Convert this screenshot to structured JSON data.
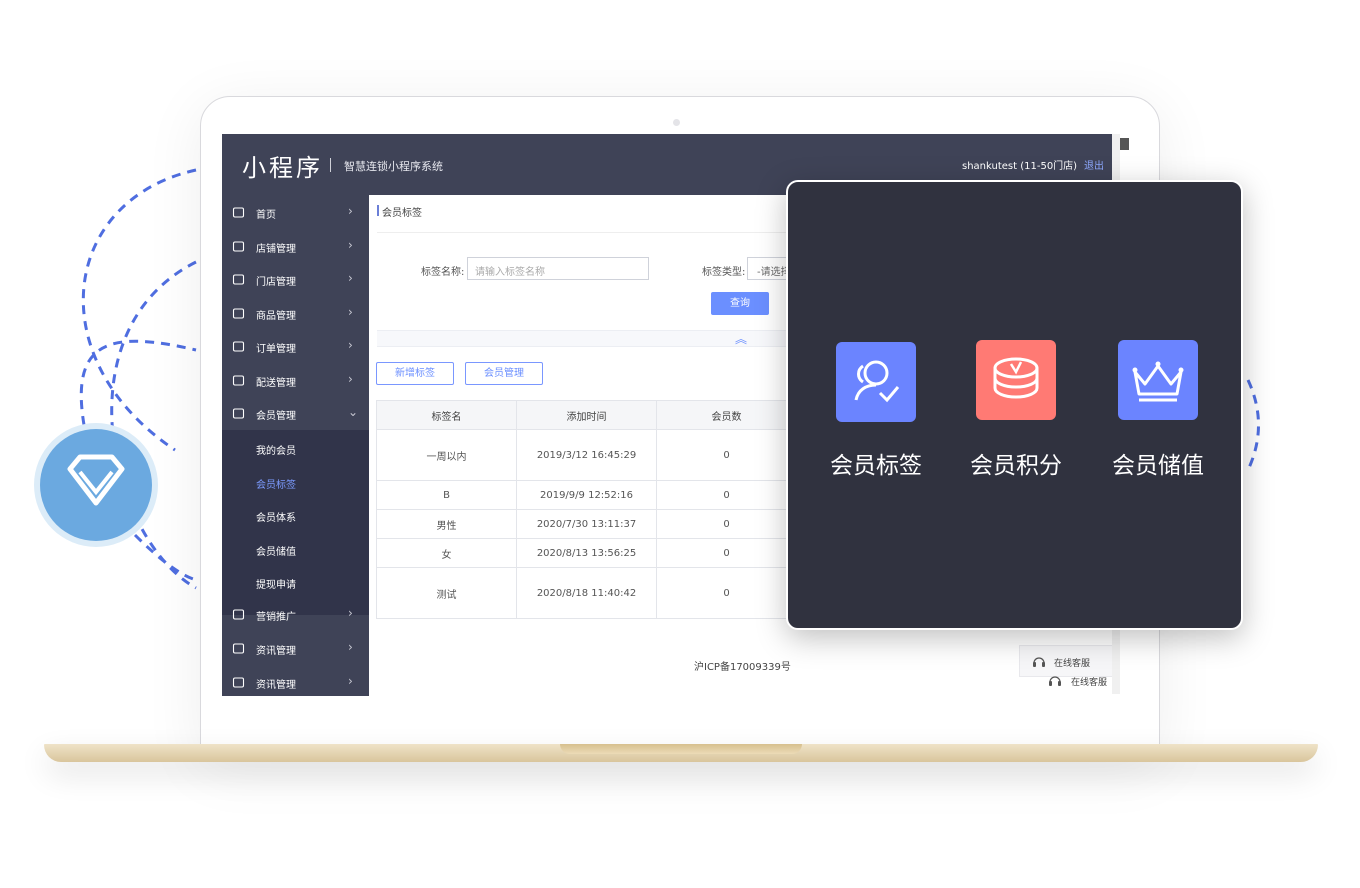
{
  "app": {
    "logo": "小程序",
    "subtitle": "智慧连锁小程序系统",
    "user": "shankutest  (11-50门店)",
    "logout": "退出"
  },
  "sidebar": {
    "items": [
      {
        "label": "首页",
        "icon": "home-icon"
      },
      {
        "label": "店铺管理",
        "icon": "shop-icon"
      },
      {
        "label": "门店管理",
        "icon": "store-icon"
      },
      {
        "label": "商品管理",
        "icon": "goods-icon"
      },
      {
        "label": "订单管理",
        "icon": "order-icon"
      },
      {
        "label": "配送管理",
        "icon": "truck-icon"
      },
      {
        "label": "会员管理",
        "icon": "member-icon"
      }
    ],
    "sub_items": [
      "我的会员",
      "会员标签",
      "会员体系",
      "会员储值",
      "提现申请"
    ],
    "tail_items": [
      {
        "label": "营销推广",
        "icon": "globe-icon"
      },
      {
        "label": "资讯管理",
        "icon": "news-icon"
      },
      {
        "label": "资讯管理",
        "icon": "news-chart-icon"
      }
    ]
  },
  "page": {
    "breadcrumb": "会员标签",
    "filter": {
      "name_label": "标签名称:",
      "name_placeholder": "请输入标签名称",
      "type_label": "标签类型:",
      "type_value": "-请选择",
      "query": "查询"
    },
    "buttons": {
      "add": "新增标签",
      "manage": "会员管理"
    },
    "table": {
      "headers": [
        "标签名",
        "添加时间",
        "会员数"
      ],
      "rows": [
        [
          "一周以内",
          "2019/3/12 16:45:29",
          "0"
        ],
        [
          "B",
          "2019/9/9 12:52:16",
          "0"
        ],
        [
          "男性",
          "2020/7/30 13:11:37",
          "0"
        ],
        [
          "女",
          "2020/8/13 13:56:25",
          "0"
        ],
        [
          "测试",
          "2020/8/18 11:40:42",
          "0"
        ]
      ]
    },
    "icp": "沪ICP备17009339号",
    "service": "在线客服"
  },
  "features": [
    {
      "label": "会员标签",
      "icon": "member-tag-icon",
      "color": "#6b84ff"
    },
    {
      "label": "会员积分",
      "icon": "coin-stack-icon",
      "color": "#ff7a74"
    },
    {
      "label": "会员储值",
      "icon": "crown-icon",
      "color": "#6b84ff"
    }
  ],
  "colors": {
    "header": "#3f4357",
    "accent": "#6b8fff",
    "card": "#30323f",
    "badge": "#6ba9e0"
  }
}
